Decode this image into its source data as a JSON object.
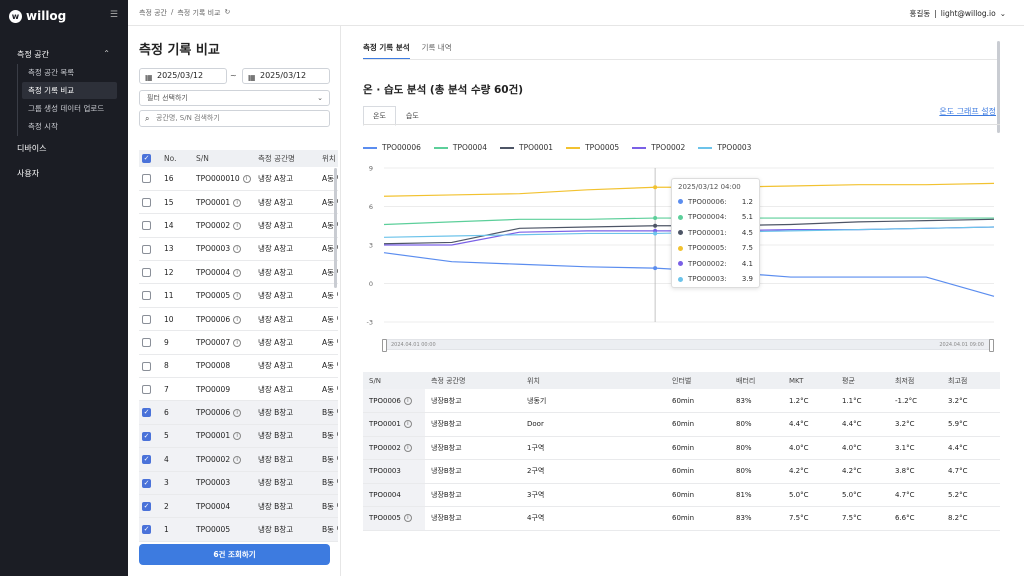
{
  "sidebar": {
    "logo_text": "willog",
    "sections": {
      "measure_space": "측정 공간",
      "devices": "디바이스",
      "users": "사용자"
    },
    "sub_items": [
      "측정 공간 목록",
      "측정 기록 비교",
      "그룹 생성 데이터 업로드",
      "측정 시작"
    ]
  },
  "topbar": {
    "breadcrumb_1": "측정 공간",
    "breadcrumb_sep": "/",
    "breadcrumb_2": "측정 기록 비교",
    "user_name": "홍길동",
    "user_email": "light@willog.io"
  },
  "left": {
    "title": "측정 기록 비교",
    "date_from": "2025/03/12",
    "date_to": "2025/03/12",
    "tilde": "~",
    "filter_placeholder": "필터 선택하기",
    "search_placeholder": "공간명, S/N 검색하기",
    "table_headers": [
      "No.",
      "S/N",
      "측정 공간명",
      "위치"
    ],
    "rows": [
      {
        "no": "16",
        "sn": "TPO000010",
        "info": true,
        "space": "냉장 A창고",
        "loc": "A동 냉",
        "checked": false
      },
      {
        "no": "15",
        "sn": "TPO0001",
        "info": true,
        "space": "냉장 A창고",
        "loc": "A동 냉",
        "checked": false
      },
      {
        "no": "14",
        "sn": "TPO0002",
        "info": true,
        "space": "냉장 A창고",
        "loc": "A동 냉",
        "checked": false
      },
      {
        "no": "13",
        "sn": "TPO0003",
        "info": true,
        "space": "냉장 A창고",
        "loc": "A동 냉",
        "checked": false
      },
      {
        "no": "12",
        "sn": "TPO0004",
        "info": true,
        "space": "냉장 A창고",
        "loc": "A동 냉",
        "checked": false
      },
      {
        "no": "11",
        "sn": "TPO0005",
        "info": true,
        "space": "냉장 A창고",
        "loc": "A동 냉",
        "checked": false
      },
      {
        "no": "10",
        "sn": "TPO0006",
        "info": true,
        "space": "냉장 A창고",
        "loc": "A동 냉",
        "checked": false
      },
      {
        "no": "9",
        "sn": "TPO0007",
        "info": true,
        "space": "냉장 A창고",
        "loc": "A동 냉",
        "checked": false
      },
      {
        "no": "8",
        "sn": "TPO0008",
        "info": false,
        "space": "냉장 A창고",
        "loc": "A동 냉",
        "checked": false
      },
      {
        "no": "7",
        "sn": "TPO0009",
        "info": false,
        "space": "냉장 A창고",
        "loc": "A동 냉",
        "checked": false
      },
      {
        "no": "6",
        "sn": "TPO0006",
        "info": true,
        "space": "냉장 B창고",
        "loc": "B동 냉",
        "checked": true
      },
      {
        "no": "5",
        "sn": "TPO0001",
        "info": true,
        "space": "냉장 B창고",
        "loc": "B동 냉",
        "checked": true
      },
      {
        "no": "4",
        "sn": "TPO0002",
        "info": true,
        "space": "냉장 B창고",
        "loc": "B동 냉",
        "checked": true
      },
      {
        "no": "3",
        "sn": "TPO0003",
        "info": false,
        "space": "냉장 B창고",
        "loc": "B동 냉",
        "checked": true
      },
      {
        "no": "2",
        "sn": "TPO0004",
        "info": false,
        "space": "냉장 B창고",
        "loc": "B동 냉",
        "checked": true
      },
      {
        "no": "1",
        "sn": "TPO0005",
        "info": false,
        "space": "냉장 B창고",
        "loc": "B동 냉",
        "checked": true
      }
    ],
    "submit_label": "6건 조회하기"
  },
  "right": {
    "tab_analysis": "측정 기록 분석",
    "tab_history": "기록 내역",
    "section_title": "온 · 습도 분석 (총 분석 수량 60건)",
    "subtab_temp": "온도",
    "subtab_humidity": "습도",
    "graph_setting_label": "온도 그래프 설정",
    "range_start": "2024.04.01 00:00",
    "range_end": "2024.04.01 09:00",
    "tooltip": {
      "title": "2025/03/12 04:00",
      "rows": [
        {
          "label": "TPO00006:",
          "value": "1.2",
          "color": "#5b8def"
        },
        {
          "label": "TPO00004:",
          "value": "5.1",
          "color": "#5ccf9a"
        },
        {
          "label": "TPO00001:",
          "value": "4.5",
          "color": "#4d5566"
        },
        {
          "label": "TPO00005:",
          "value": "7.5",
          "color": "#f2c230"
        },
        {
          "label": "TPO00002:",
          "value": "4.1",
          "color": "#7a60e6"
        },
        {
          "label": "TPO00003:",
          "value": "3.9",
          "color": "#6cc3ea"
        }
      ]
    },
    "table": {
      "headers": [
        "S/N",
        "측정 공간명",
        "위치",
        "인터벌",
        "배터리",
        "MKT",
        "평균",
        "최저점",
        "최고점"
      ],
      "rows": [
        {
          "sn": "TPO0006",
          "info": true,
          "space": "냉장B창고",
          "loc": "냉동기",
          "interval": "60min",
          "battery": "83%",
          "mkt": "1.2°C",
          "avg": "1.1°C",
          "min": "-1.2°C",
          "max": "3.2°C"
        },
        {
          "sn": "TPO0001",
          "info": true,
          "space": "냉장B창고",
          "loc": "Door",
          "interval": "60min",
          "battery": "80%",
          "mkt": "4.4°C",
          "avg": "4.4°C",
          "min": "3.2°C",
          "max": "5.9°C"
        },
        {
          "sn": "TPO0002",
          "info": true,
          "space": "냉장B창고",
          "loc": "1구역",
          "interval": "60min",
          "battery": "80%",
          "mkt": "4.0°C",
          "avg": "4.0°C",
          "min": "3.1°C",
          "max": "4.4°C"
        },
        {
          "sn": "TPO0003",
          "info": false,
          "space": "냉장B창고",
          "loc": "2구역",
          "interval": "60min",
          "battery": "80%",
          "mkt": "4.2°C",
          "avg": "4.2°C",
          "min": "3.8°C",
          "max": "4.7°C"
        },
        {
          "sn": "TPO0004",
          "info": false,
          "space": "냉장B창고",
          "loc": "3구역",
          "interval": "60min",
          "battery": "81%",
          "mkt": "5.0°C",
          "avg": "5.0°C",
          "min": "4.7°C",
          "max": "5.2°C"
        },
        {
          "sn": "TPO0005",
          "info": true,
          "space": "냉장B창고",
          "loc": "4구역",
          "interval": "60min",
          "battery": "83%",
          "mkt": "7.5°C",
          "avg": "7.5°C",
          "min": "6.6°C",
          "max": "8.2°C"
        }
      ]
    }
  },
  "chart_data": {
    "type": "line",
    "title": "",
    "xlabel": "",
    "ylabel": "",
    "ylim": [
      -3,
      9
    ],
    "yticks": [
      9,
      6,
      3,
      0,
      -3
    ],
    "x": [
      0,
      1,
      2,
      3,
      4,
      5,
      6,
      7,
      8,
      9
    ],
    "grid": true,
    "legend_position": "top",
    "series": [
      {
        "name": "TPO00006",
        "color": "#5b8def",
        "values": [
          2.4,
          1.7,
          1.5,
          1.3,
          1.2,
          0.9,
          0.5,
          0.5,
          0.5,
          -1.0
        ]
      },
      {
        "name": "TPO0004",
        "color": "#5ccf9a",
        "values": [
          4.6,
          4.8,
          5.0,
          5.0,
          5.1,
          5.1,
          5.1,
          5.1,
          5.1,
          5.1
        ]
      },
      {
        "name": "TPO0001",
        "color": "#4d5566",
        "values": [
          3.1,
          3.2,
          4.3,
          4.4,
          4.5,
          4.5,
          4.6,
          4.8,
          4.9,
          5.0
        ]
      },
      {
        "name": "TPO0005",
        "color": "#f2c230",
        "values": [
          6.8,
          6.9,
          7.0,
          7.3,
          7.5,
          7.5,
          7.6,
          7.7,
          7.7,
          7.8
        ]
      },
      {
        "name": "TPO0002",
        "color": "#7a60e6",
        "values": [
          3.0,
          3.0,
          4.0,
          4.1,
          4.1,
          4.1,
          4.2,
          4.2,
          4.3,
          4.4
        ]
      },
      {
        "name": "TPO0003",
        "color": "#6cc3ea",
        "values": [
          3.6,
          3.7,
          3.8,
          3.9,
          3.9,
          4.0,
          4.1,
          4.2,
          4.3,
          4.4
        ]
      }
    ],
    "hover_index": 4
  }
}
